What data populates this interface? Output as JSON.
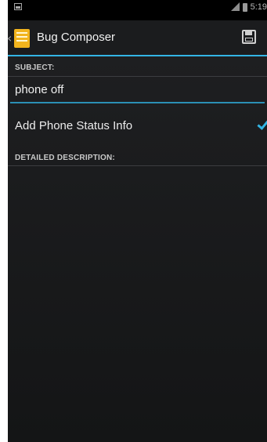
{
  "status_bar": {
    "time": "5:19",
    "icons": [
      "notification-icon",
      "signal-icon",
      "battery-icon"
    ]
  },
  "action_bar": {
    "back_glyph": "‹",
    "title": "Bug Composer",
    "save_icon": "save-icon"
  },
  "form": {
    "subject_label": "SUBJECT:",
    "subject_value": "phone off",
    "phone_status_label": "Add Phone Status Info",
    "phone_status_checked": true,
    "description_label": "DETAILED DESCRIPTION:",
    "description_value": ""
  },
  "colors": {
    "accent": "#33b5e5",
    "background": "#1b1c1e",
    "app_icon": "#f2b41e"
  }
}
